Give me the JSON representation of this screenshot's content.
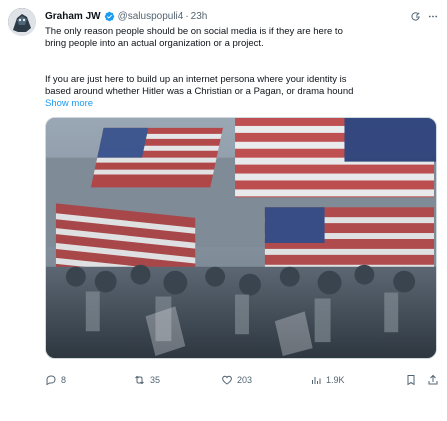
{
  "author": {
    "name": "Graham JW",
    "handle": "@saluspopuli4",
    "separator": "·",
    "time": "23h",
    "verified_color": "#1d9bf0"
  },
  "icons": {
    "avatar": "avatar-image",
    "verified": "verified-badge-icon",
    "grok": "grok-icon",
    "more": "more-dots-icon",
    "reply": "reply-icon",
    "repost": "repost-icon",
    "like": "heart-icon",
    "views": "views-chart-icon",
    "bookmark": "bookmark-icon",
    "share": "share-icon"
  },
  "content": {
    "paragraph1_line1": "The only reason people should be on social media is if they are here to",
    "paragraph1_line2": "bring people into an actual organization or a project.",
    "paragraph2_line1": "If you are just here to build up an internet persona where your identity is",
    "paragraph2_line2": "based around whether Hitler was a Christian or a Pagan, or drama hound",
    "show_more": "Show more"
  },
  "media": {
    "description_icon": "rally-crowd-with-flags-image"
  },
  "metrics": {
    "replies": "8",
    "reposts": "35",
    "likes": "203",
    "views": "1.9K"
  },
  "colors": {
    "link": "#1d9bf0",
    "muted": "#536471",
    "text": "#0f1419"
  }
}
